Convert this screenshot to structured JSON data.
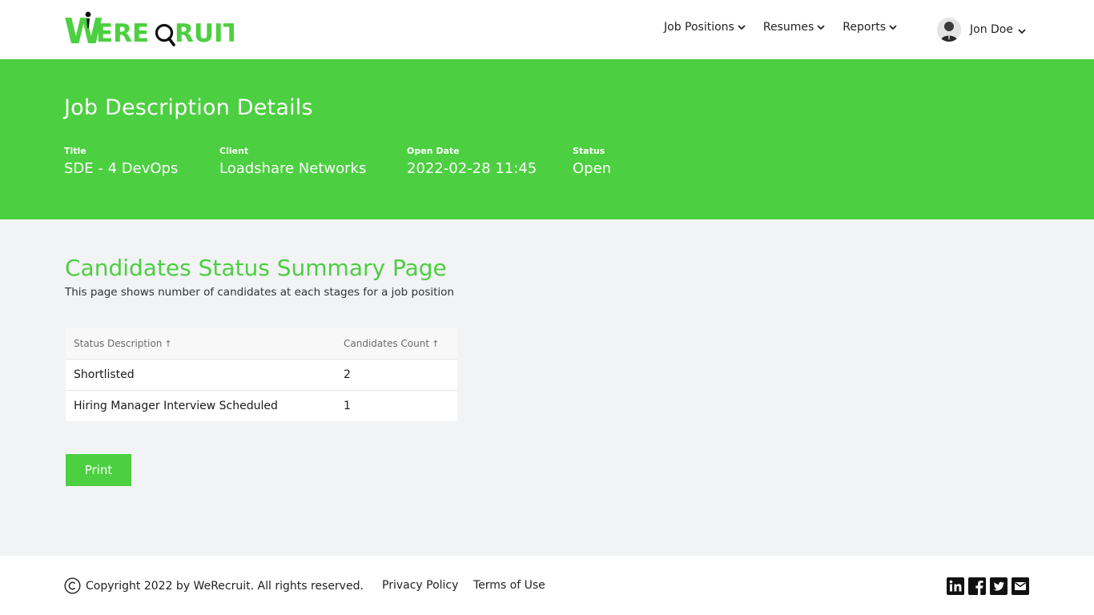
{
  "brand": {
    "logo_text": "WERECRUIT",
    "accent_color": "#4ccf40"
  },
  "nav": {
    "items": [
      {
        "label": "Job Positions"
      },
      {
        "label": "Resumes"
      },
      {
        "label": "Reports"
      }
    ],
    "user_name": "Jon Doe"
  },
  "hero": {
    "title": "Job Description Details",
    "fields": {
      "title_label": "Title",
      "title_value": "SDE - 4 DevOps",
      "client_label": "Client",
      "client_value": "Loadshare Networks",
      "open_date_label": "Open Date",
      "open_date_value": "2022-02-28 11:45",
      "status_label": "Status",
      "status_value": "Open"
    }
  },
  "summary": {
    "title": "Candidates Status Summary Page",
    "subtitle": "This page shows number of candidates at each stages for a job position",
    "columns": [
      "Status Description",
      "Candidates Count"
    ],
    "sort_icon": "arrow-up-icon",
    "rows": [
      {
        "status": "Shortlisted",
        "count": "2"
      },
      {
        "status": "Hiring Manager Interview Scheduled",
        "count": "1"
      }
    ],
    "print_label": "Print"
  },
  "footer": {
    "copyright": "Copyright 2022 by WeRecruit. All rights reserved.",
    "privacy": "Privacy Policy",
    "terms": "Terms of Use",
    "social_icons": [
      "linkedin-icon",
      "facebook-icon",
      "twitter-icon",
      "email-icon"
    ]
  }
}
